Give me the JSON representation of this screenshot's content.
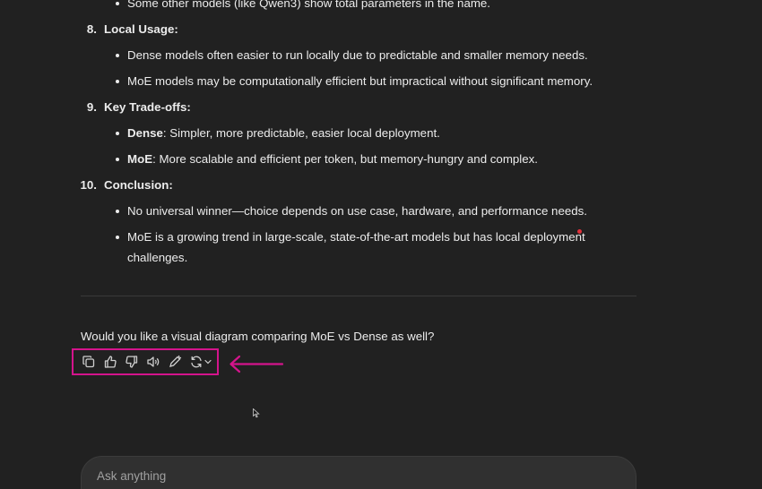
{
  "content": {
    "top_partial_bullet": "Some other models (like Qwen3) show total parameters in the name.",
    "sections": [
      {
        "number": "8.",
        "heading": "Local Usage:",
        "bullets": [
          {
            "bold": "",
            "text": "Dense models often easier to run locally due to predictable and smaller memory needs."
          },
          {
            "bold": "",
            "text": "MoE models may be computationally efficient but impractical without significant memory."
          }
        ]
      },
      {
        "number": "9.",
        "heading": "Key Trade-offs:",
        "bullets": [
          {
            "bold": "Dense",
            "text": ": Simpler, more predictable, easier local deployment."
          },
          {
            "bold": "MoE",
            "text": ": More scalable and efficient per token, but memory-hungry and complex."
          }
        ]
      },
      {
        "number": "10.",
        "heading": "Conclusion:",
        "bullets": [
          {
            "bold": "",
            "text": "No universal winner—choice depends on use case, hardware, and performance needs."
          },
          {
            "bold": "",
            "text": "MoE is a growing trend in large-scale, state-of-the-art models but has local deployment",
            "continuation": "challenges."
          }
        ]
      }
    ],
    "follow_up_question": "Would you like a visual diagram comparing MoE vs Dense as well?"
  },
  "actions": [
    {
      "name": "copy-icon"
    },
    {
      "name": "thumbs-up-icon"
    },
    {
      "name": "thumbs-down-icon"
    },
    {
      "name": "read-aloud-icon"
    },
    {
      "name": "edit-icon"
    },
    {
      "name": "regenerate-icon"
    }
  ],
  "annotation_color": "#d4148c",
  "composer": {
    "placeholder": "Ask anything"
  }
}
